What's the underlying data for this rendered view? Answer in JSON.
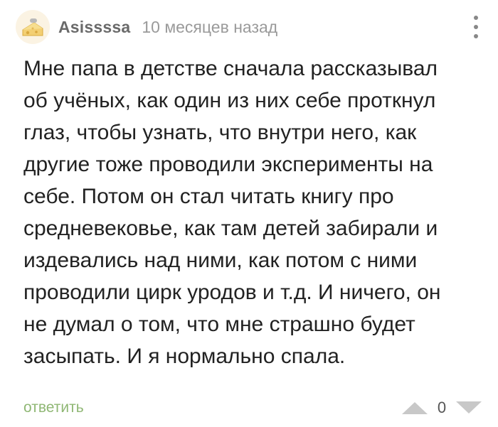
{
  "comment": {
    "author": "Asissssa",
    "timestamp": "10 месяцев назад",
    "text": "Мне папа в детстве сначала рассказывал\nоб учёных, как один из них себе проткнул\nглаз, чтобы узнать, что внутри него, как\nдругие тоже проводили эксперименты на\nсебе. Потом он стал читать книгу про\nсредневековье, как там детей забирали и\nиздевались над ними, как потом с ними\nпроводили цирк уродов и т.д. И ничего, он\nне думал о том, что мне страшно будет\nзасыпать. И я нормально спала.",
    "avatar_icon": "cheese-avatar-icon",
    "more_icon": "vertical-dots-icon"
  },
  "footer": {
    "reply_label": "ответить",
    "score": "0",
    "upvote_icon": "triangle-up-icon",
    "downvote_icon": "triangle-down-icon"
  },
  "colors": {
    "reply": "#8fb774",
    "vote_arrows": "#c8c8c8",
    "username": "#6a6a6a",
    "timestamp": "#9a9a9a"
  }
}
